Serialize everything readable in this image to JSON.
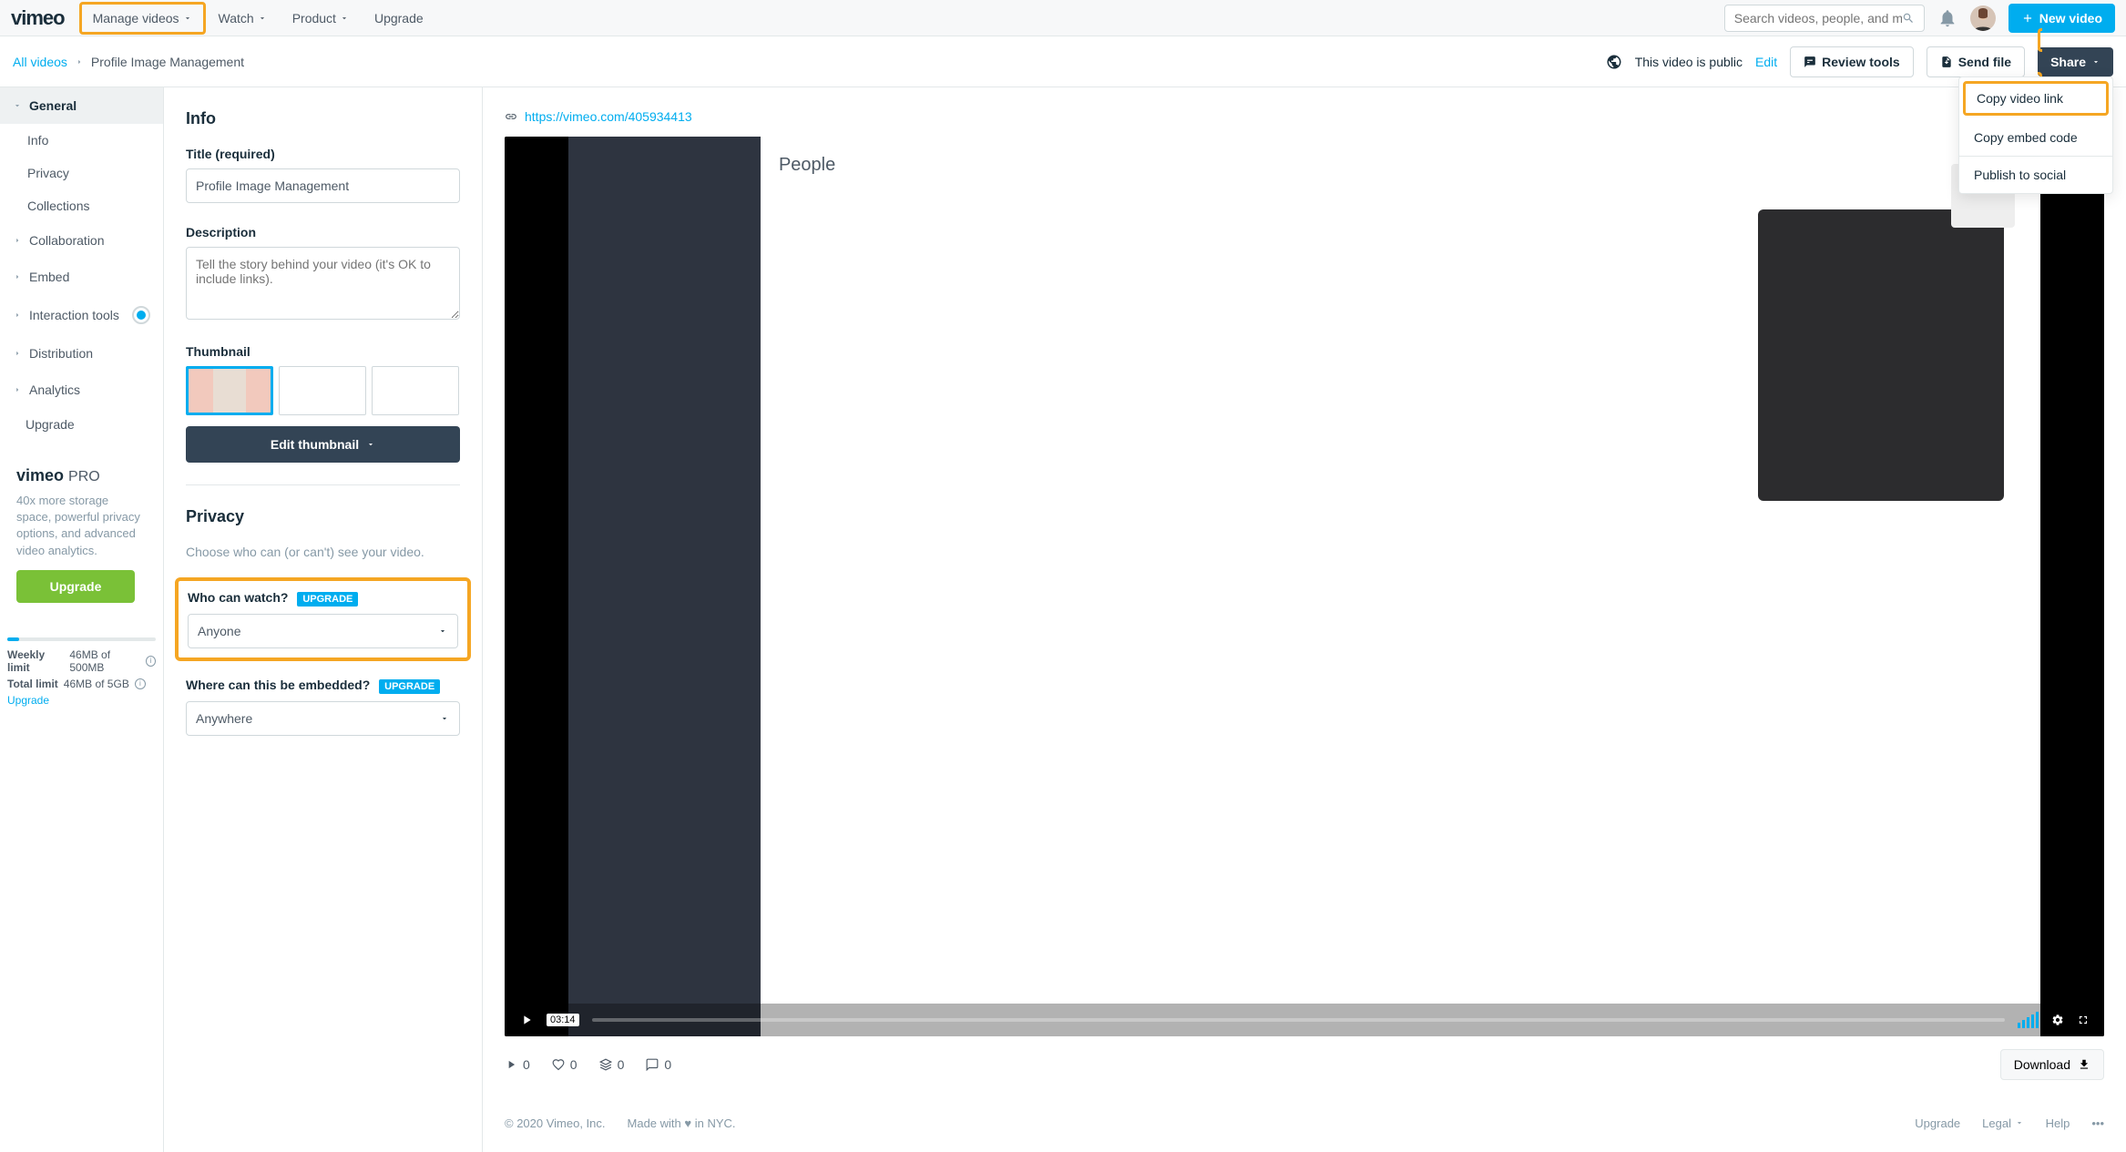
{
  "topnav": {
    "logo": "vimeo",
    "items": [
      "Manage videos",
      "Watch",
      "Product",
      "Upgrade"
    ],
    "search_placeholder": "Search videos, people, and more",
    "new_video": "New video"
  },
  "crumbbar": {
    "back": "All videos",
    "current": "Profile Image Management",
    "public_text": "This video is public",
    "edit": "Edit",
    "review": "Review tools",
    "send": "Send file",
    "share": "Share"
  },
  "share_menu": {
    "copy_link": "Copy video link",
    "copy_embed": "Copy embed code",
    "publish": "Publish to social"
  },
  "sidebar": {
    "general": "General",
    "info": "Info",
    "privacy": "Privacy",
    "collections": "Collections",
    "collaboration": "Collaboration",
    "embed": "Embed",
    "interaction": "Interaction tools",
    "distribution": "Distribution",
    "analytics": "Analytics",
    "upgrade": "Upgrade"
  },
  "promo": {
    "brand": "vimeo",
    "tier": "PRO",
    "text": "40x more storage space, powerful privacy options, and advanced video analytics.",
    "button": "Upgrade"
  },
  "limits": {
    "weekly_label": "Weekly limit",
    "weekly_value": "46MB of 500MB",
    "total_label": "Total limit",
    "total_value": "46MB of 5GB",
    "upgrade": "Upgrade"
  },
  "form": {
    "info_title": "Info",
    "title_label": "Title (required)",
    "title_value": "Profile Image Management",
    "desc_label": "Description",
    "desc_placeholder": "Tell the story behind your video (it's OK to include links).",
    "thumb_label": "Thumbnail",
    "edit_thumb": "Edit thumbnail",
    "privacy_title": "Privacy",
    "privacy_sub": "Choose who can (or can't) see your video.",
    "watch_label": "Who can watch?",
    "watch_value": "Anyone",
    "embed_label": "Where can this be embedded?",
    "embed_value": "Anywhere",
    "upgrade_badge": "UPGRADE"
  },
  "video": {
    "url": "https://vimeo.com/405934413",
    "time": "03:14",
    "ps_title": "People"
  },
  "stats": {
    "plays": "0",
    "likes": "0",
    "collections": "0",
    "comments": "0",
    "download": "Download"
  },
  "footer": {
    "copyright": "© 2020 Vimeo, Inc.",
    "made": "Made with",
    "nyc": "in NYC.",
    "upgrade": "Upgrade",
    "legal": "Legal",
    "help": "Help"
  }
}
